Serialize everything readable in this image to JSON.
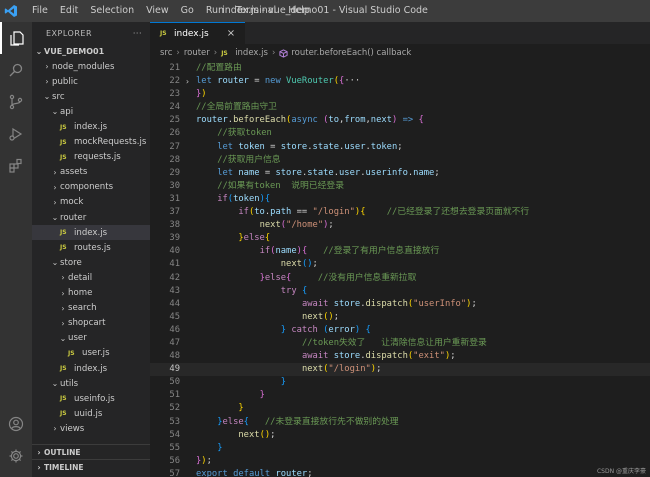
{
  "titlebar": {
    "menu": [
      "File",
      "Edit",
      "Selection",
      "View",
      "Go",
      "Run",
      "Terminal",
      "Help"
    ],
    "title": "index.js - vue_demo01 - Visual Studio Code"
  },
  "colors": {
    "keyword": "#569cd6",
    "control": "#c586c0",
    "variable": "#9cdcfe",
    "function": "#dcdcaa",
    "class": "#4ec9b0",
    "string": "#ce9178",
    "comment": "#6a9955",
    "plain": "#d4d4d4",
    "bracket1": "#ffd700",
    "bracket2": "#da70d6",
    "bracket3": "#179fff"
  },
  "sidebar": {
    "title": "EXPLORER",
    "more": "···",
    "root": "VUE_DEMO01",
    "tree": [
      {
        "label": "node_modules",
        "depth": 1,
        "type": "folder",
        "open": false
      },
      {
        "label": "public",
        "depth": 1,
        "type": "folder",
        "open": false
      },
      {
        "label": "src",
        "depth": 1,
        "type": "folder",
        "open": true
      },
      {
        "label": "api",
        "depth": 2,
        "type": "folder",
        "open": true
      },
      {
        "label": "index.js",
        "depth": 3,
        "type": "js"
      },
      {
        "label": "mockRequests.js",
        "depth": 3,
        "type": "js"
      },
      {
        "label": "requests.js",
        "depth": 3,
        "type": "js"
      },
      {
        "label": "assets",
        "depth": 2,
        "type": "folder",
        "open": false
      },
      {
        "label": "components",
        "depth": 2,
        "type": "folder",
        "open": false
      },
      {
        "label": "mock",
        "depth": 2,
        "type": "folder",
        "open": false
      },
      {
        "label": "router",
        "depth": 2,
        "type": "folder",
        "open": true
      },
      {
        "label": "index.js",
        "depth": 3,
        "type": "js",
        "selected": true
      },
      {
        "label": "routes.js",
        "depth": 3,
        "type": "js"
      },
      {
        "label": "store",
        "depth": 2,
        "type": "folder",
        "open": true
      },
      {
        "label": "detail",
        "depth": 3,
        "type": "folder",
        "open": false
      },
      {
        "label": "home",
        "depth": 3,
        "type": "folder",
        "open": false
      },
      {
        "label": "search",
        "depth": 3,
        "type": "folder",
        "open": false
      },
      {
        "label": "shopcart",
        "depth": 3,
        "type": "folder",
        "open": false
      },
      {
        "label": "user",
        "depth": 3,
        "type": "folder",
        "open": true
      },
      {
        "label": "user.js",
        "depth": 4,
        "type": "js"
      },
      {
        "label": "index.js",
        "depth": 3,
        "type": "js"
      },
      {
        "label": "utils",
        "depth": 2,
        "type": "folder",
        "open": true
      },
      {
        "label": "useinfo.js",
        "depth": 3,
        "type": "js"
      },
      {
        "label": "uuid.js",
        "depth": 3,
        "type": "js"
      },
      {
        "label": "views",
        "depth": 2,
        "type": "folder",
        "open": false
      }
    ],
    "sections": [
      "OUTLINE",
      "TIMELINE"
    ]
  },
  "editor": {
    "tab": {
      "badge": "JS",
      "label": "index.js",
      "close": "×"
    },
    "breadcrumb": [
      "src",
      "router",
      "index.js",
      "router.beforeEach() callback"
    ],
    "current_line": 49,
    "lines": [
      {
        "n": 21,
        "tokens": [
          [
            "comment",
            "//配置路由"
          ]
        ]
      },
      {
        "n": 22,
        "fold": "›",
        "tokens": [
          [
            "keyword",
            "let"
          ],
          [
            "plain",
            " "
          ],
          [
            "variable",
            "router"
          ],
          [
            "plain",
            " = "
          ],
          [
            "keyword",
            "new"
          ],
          [
            "plain",
            " "
          ],
          [
            "class",
            "VueRouter"
          ],
          [
            "bracket1",
            "("
          ],
          [
            "bracket2",
            "{"
          ],
          [
            "plain",
            "···"
          ]
        ]
      },
      {
        "n": 23,
        "tokens": [
          [
            "bracket2",
            "}"
          ],
          [
            "bracket1",
            ")"
          ]
        ]
      },
      {
        "n": 24,
        "tokens": [
          [
            "comment",
            "//全局前置路由守卫"
          ]
        ]
      },
      {
        "n": 25,
        "tokens": [
          [
            "variable",
            "router"
          ],
          [
            "plain",
            "."
          ],
          [
            "function",
            "beforeEach"
          ],
          [
            "bracket1",
            "("
          ],
          [
            "keyword",
            "async"
          ],
          [
            "plain",
            " "
          ],
          [
            "bracket2",
            "("
          ],
          [
            "variable",
            "to"
          ],
          [
            "plain",
            ","
          ],
          [
            "variable",
            "from"
          ],
          [
            "plain",
            ","
          ],
          [
            "variable",
            "next"
          ],
          [
            "bracket2",
            ")"
          ],
          [
            "plain",
            " "
          ],
          [
            "keyword",
            "=>"
          ],
          [
            "plain",
            " "
          ],
          [
            "bracket2",
            "{"
          ]
        ]
      },
      {
        "n": 26,
        "tokens": [
          [
            "plain",
            "    "
          ],
          [
            "comment",
            "//获取token"
          ]
        ]
      },
      {
        "n": 27,
        "tokens": [
          [
            "plain",
            "    "
          ],
          [
            "keyword",
            "let"
          ],
          [
            "plain",
            " "
          ],
          [
            "variable",
            "token"
          ],
          [
            "plain",
            " = "
          ],
          [
            "variable",
            "store"
          ],
          [
            "plain",
            "."
          ],
          [
            "variable",
            "state"
          ],
          [
            "plain",
            "."
          ],
          [
            "variable",
            "user"
          ],
          [
            "plain",
            "."
          ],
          [
            "variable",
            "token"
          ],
          [
            "plain",
            ";"
          ]
        ]
      },
      {
        "n": 28,
        "tokens": [
          [
            "plain",
            "    "
          ],
          [
            "comment",
            "//获取用户信息"
          ]
        ]
      },
      {
        "n": 29,
        "tokens": [
          [
            "plain",
            "    "
          ],
          [
            "keyword",
            "let"
          ],
          [
            "plain",
            " "
          ],
          [
            "variable",
            "name"
          ],
          [
            "plain",
            " = "
          ],
          [
            "variable",
            "store"
          ],
          [
            "plain",
            "."
          ],
          [
            "variable",
            "state"
          ],
          [
            "plain",
            "."
          ],
          [
            "variable",
            "user"
          ],
          [
            "plain",
            "."
          ],
          [
            "variable",
            "userinfo"
          ],
          [
            "plain",
            "."
          ],
          [
            "variable",
            "name"
          ],
          [
            "plain",
            ";"
          ]
        ]
      },
      {
        "n": 30,
        "tokens": [
          [
            "plain",
            "    "
          ],
          [
            "comment",
            "//如果有token  说明已经登录"
          ]
        ]
      },
      {
        "n": 31,
        "tokens": [
          [
            "plain",
            "    "
          ],
          [
            "control",
            "if"
          ],
          [
            "bracket3",
            "("
          ],
          [
            "variable",
            "token"
          ],
          [
            "bracket3",
            ")"
          ],
          [
            "bracket3",
            "{"
          ]
        ]
      },
      {
        "n": 37,
        "tokens": [
          [
            "plain",
            "        "
          ],
          [
            "control",
            "if"
          ],
          [
            "bracket1",
            "("
          ],
          [
            "variable",
            "to"
          ],
          [
            "plain",
            "."
          ],
          [
            "variable",
            "path"
          ],
          [
            "plain",
            " == "
          ],
          [
            "string",
            "\"/login\""
          ],
          [
            "bracket1",
            ")"
          ],
          [
            "bracket1",
            "{"
          ],
          [
            "plain",
            "    "
          ],
          [
            "comment",
            "//已经登录了还想去登录页面就不行"
          ]
        ]
      },
      {
        "n": 38,
        "tokens": [
          [
            "plain",
            "            "
          ],
          [
            "function",
            "next"
          ],
          [
            "bracket2",
            "("
          ],
          [
            "string",
            "\"/home\""
          ],
          [
            "bracket2",
            ")"
          ],
          [
            "plain",
            ";"
          ]
        ]
      },
      {
        "n": 39,
        "tokens": [
          [
            "plain",
            "        "
          ],
          [
            "bracket1",
            "}"
          ],
          [
            "control",
            "else"
          ],
          [
            "bracket1",
            "{"
          ]
        ]
      },
      {
        "n": 40,
        "tokens": [
          [
            "plain",
            "            "
          ],
          [
            "control",
            "if"
          ],
          [
            "bracket2",
            "("
          ],
          [
            "variable",
            "name"
          ],
          [
            "bracket2",
            ")"
          ],
          [
            "bracket2",
            "{"
          ],
          [
            "plain",
            "   "
          ],
          [
            "comment",
            "//登录了有用户信息直接放行"
          ]
        ]
      },
      {
        "n": 41,
        "tokens": [
          [
            "plain",
            "                "
          ],
          [
            "function",
            "next"
          ],
          [
            "bracket3",
            "("
          ],
          [
            "bracket3",
            ")"
          ],
          [
            "plain",
            ";"
          ]
        ]
      },
      {
        "n": 42,
        "tokens": [
          [
            "plain",
            "            "
          ],
          [
            "bracket2",
            "}"
          ],
          [
            "control",
            "else"
          ],
          [
            "bracket2",
            "{"
          ],
          [
            "plain",
            "     "
          ],
          [
            "comment",
            "//没有用户信息重新拉取"
          ]
        ]
      },
      {
        "n": 43,
        "tokens": [
          [
            "plain",
            "                "
          ],
          [
            "control",
            "try"
          ],
          [
            "plain",
            " "
          ],
          [
            "bracket3",
            "{"
          ]
        ]
      },
      {
        "n": 44,
        "tokens": [
          [
            "plain",
            "                    "
          ],
          [
            "control",
            "await"
          ],
          [
            "plain",
            " "
          ],
          [
            "variable",
            "store"
          ],
          [
            "plain",
            "."
          ],
          [
            "function",
            "dispatch"
          ],
          [
            "bracket1",
            "("
          ],
          [
            "string",
            "\"userInfo\""
          ],
          [
            "bracket1",
            ")"
          ],
          [
            "plain",
            ";"
          ]
        ]
      },
      {
        "n": 45,
        "tokens": [
          [
            "plain",
            "                    "
          ],
          [
            "function",
            "next"
          ],
          [
            "bracket1",
            "("
          ],
          [
            "bracket1",
            ")"
          ],
          [
            "plain",
            ";"
          ]
        ]
      },
      {
        "n": 46,
        "tokens": [
          [
            "plain",
            "                "
          ],
          [
            "bracket3",
            "}"
          ],
          [
            "plain",
            " "
          ],
          [
            "control",
            "catch"
          ],
          [
            "plain",
            " "
          ],
          [
            "bracket3",
            "("
          ],
          [
            "variable",
            "error"
          ],
          [
            "bracket3",
            ")"
          ],
          [
            "plain",
            " "
          ],
          [
            "bracket3",
            "{"
          ]
        ]
      },
      {
        "n": 47,
        "tokens": [
          [
            "plain",
            "                    "
          ],
          [
            "comment",
            "//token失效了   让清除信息让用户重新登录"
          ]
        ]
      },
      {
        "n": 48,
        "tokens": [
          [
            "plain",
            "                    "
          ],
          [
            "control",
            "await"
          ],
          [
            "plain",
            " "
          ],
          [
            "variable",
            "store"
          ],
          [
            "plain",
            "."
          ],
          [
            "function",
            "dispatch"
          ],
          [
            "bracket1",
            "("
          ],
          [
            "string",
            "\"exit\""
          ],
          [
            "bracket1",
            ")"
          ],
          [
            "plain",
            ";"
          ]
        ]
      },
      {
        "n": 49,
        "tokens": [
          [
            "plain",
            "                    "
          ],
          [
            "function",
            "next"
          ],
          [
            "bracket1",
            "("
          ],
          [
            "string",
            "\"/login\""
          ],
          [
            "bracket1",
            ")"
          ],
          [
            "plain",
            ";"
          ]
        ]
      },
      {
        "n": 50,
        "tokens": [
          [
            "plain",
            "                "
          ],
          [
            "bracket3",
            "}"
          ]
        ]
      },
      {
        "n": 51,
        "tokens": [
          [
            "plain",
            "            "
          ],
          [
            "bracket2",
            "}"
          ]
        ]
      },
      {
        "n": 52,
        "tokens": [
          [
            "plain",
            "        "
          ],
          [
            "bracket1",
            "}"
          ]
        ]
      },
      {
        "n": 53,
        "tokens": [
          [
            "plain",
            "    "
          ],
          [
            "bracket3",
            "}"
          ],
          [
            "control",
            "else"
          ],
          [
            "bracket3",
            "{"
          ],
          [
            "plain",
            "   "
          ],
          [
            "comment",
            "//未登录直接放行先不做别的处理"
          ]
        ]
      },
      {
        "n": 54,
        "tokens": [
          [
            "plain",
            "        "
          ],
          [
            "function",
            "next"
          ],
          [
            "bracket1",
            "("
          ],
          [
            "bracket1",
            ")"
          ],
          [
            "plain",
            ";"
          ]
        ]
      },
      {
        "n": 55,
        "tokens": [
          [
            "plain",
            "    "
          ],
          [
            "bracket3",
            "}"
          ]
        ]
      },
      {
        "n": 56,
        "tokens": [
          [
            "bracket2",
            "}"
          ],
          [
            "bracket1",
            ")"
          ],
          [
            "plain",
            ";"
          ]
        ]
      },
      {
        "n": 57,
        "tokens": [
          [
            "keyword",
            "export"
          ],
          [
            "plain",
            " "
          ],
          [
            "keyword",
            "default"
          ],
          [
            "plain",
            " "
          ],
          [
            "variable",
            "router"
          ],
          [
            "plain",
            ";"
          ]
        ]
      }
    ]
  },
  "watermark": "CSDN @重庆李豪"
}
